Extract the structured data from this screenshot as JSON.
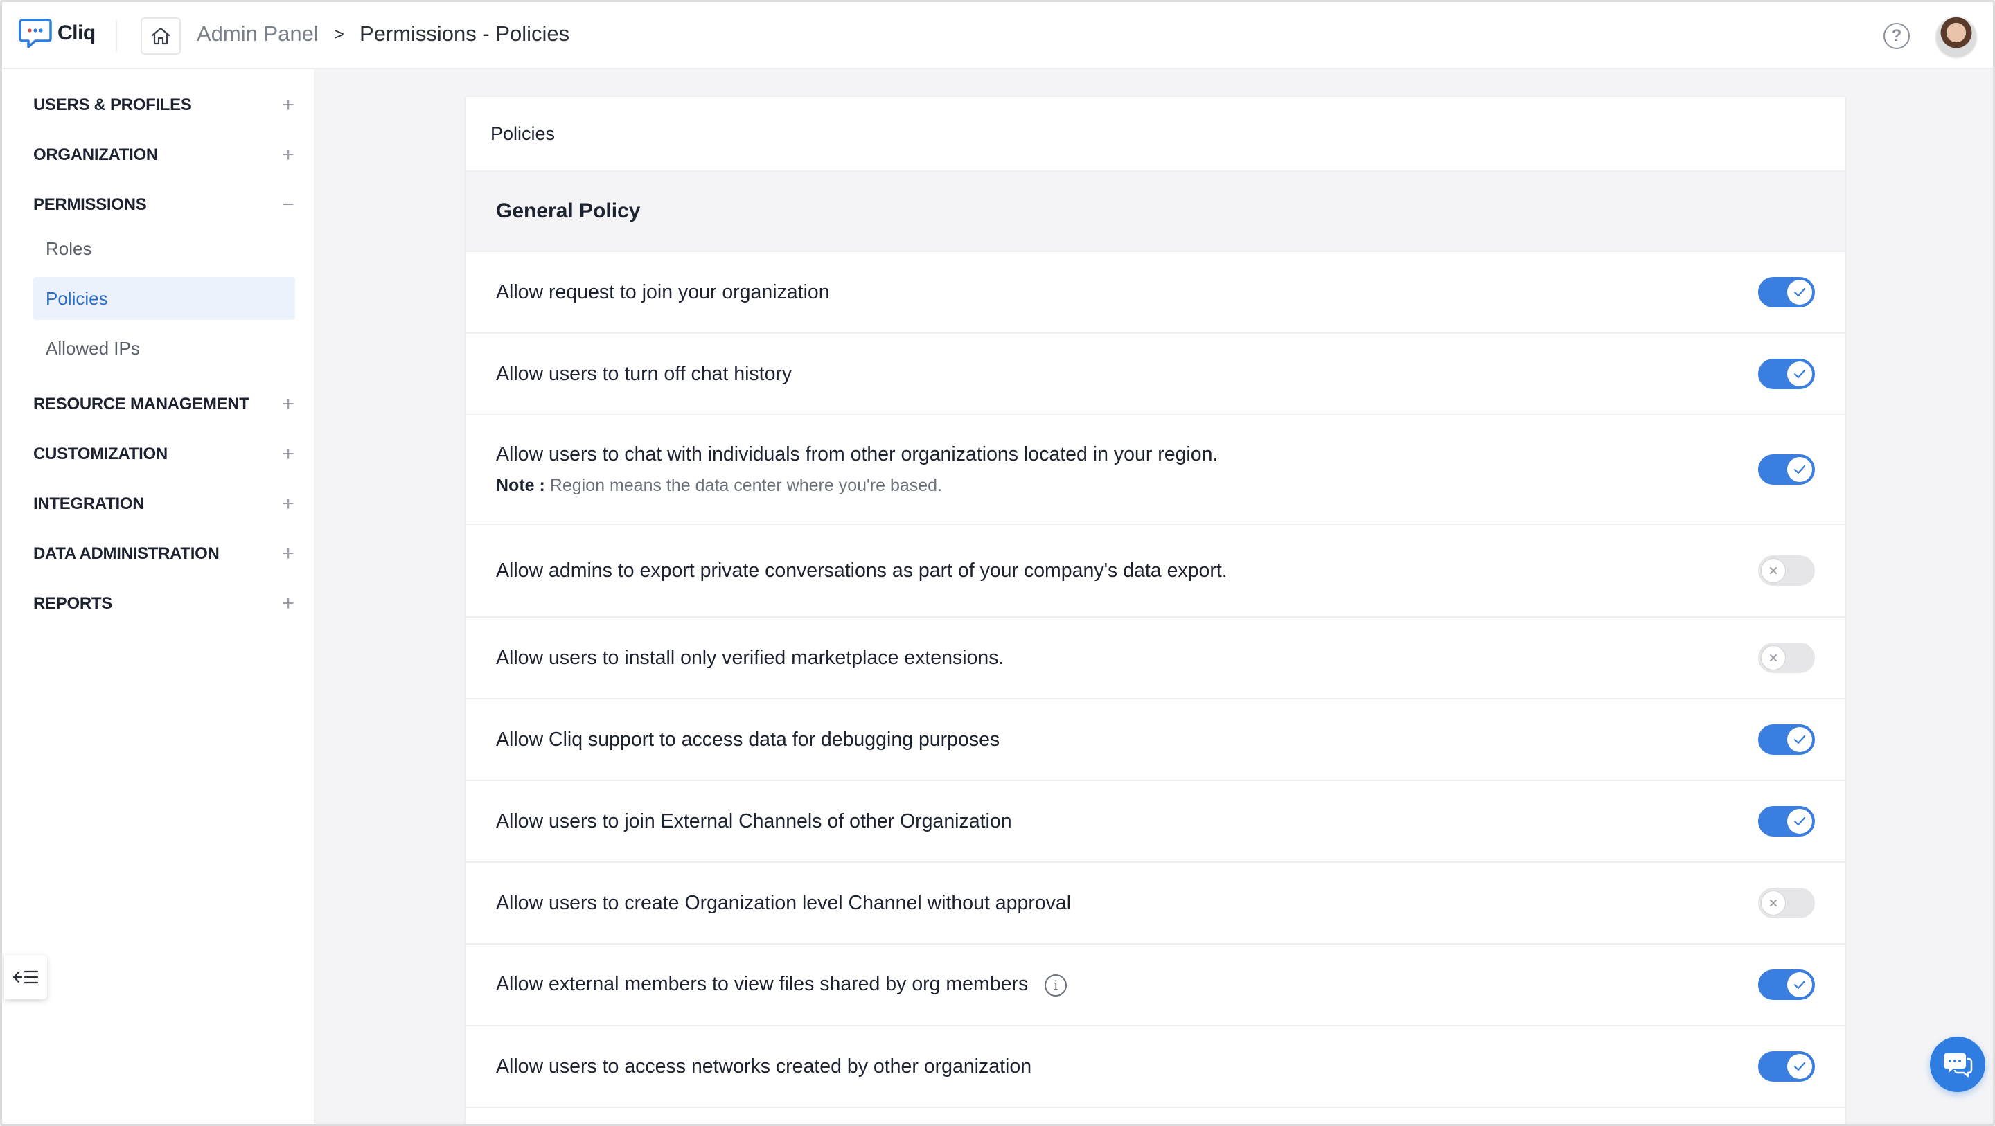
{
  "app": {
    "name": "Cliq"
  },
  "breadcrumb": {
    "root": "Admin Panel",
    "separator": ">",
    "current": "Permissions - Policies"
  },
  "sidebar": {
    "sections": [
      {
        "label": "USERS & PROFILES",
        "toggle": "+"
      },
      {
        "label": "ORGANIZATION",
        "toggle": "+"
      },
      {
        "label": "PERMISSIONS",
        "toggle": "−"
      },
      {
        "label": "RESOURCE MANAGEMENT",
        "toggle": "+"
      },
      {
        "label": "CUSTOMIZATION",
        "toggle": "+"
      },
      {
        "label": "INTEGRATION",
        "toggle": "+"
      },
      {
        "label": "DATA ADMINISTRATION",
        "toggle": "+"
      },
      {
        "label": "REPORTS",
        "toggle": "+"
      }
    ],
    "permissions_items": [
      {
        "label": "Roles",
        "active": false
      },
      {
        "label": "Policies",
        "active": true
      },
      {
        "label": "Allowed IPs",
        "active": false
      }
    ]
  },
  "main": {
    "card_title": "Policies",
    "section_title": "General Policy",
    "policies": [
      {
        "label": "Allow request to join your organization",
        "enabled": true
      },
      {
        "label": "Allow users to turn off chat history",
        "enabled": true
      },
      {
        "label": "Allow users to chat with individuals from other organizations located in your region.",
        "note_label": "Note :",
        "note_text": "Region means the data center where you're based.",
        "enabled": true
      },
      {
        "label": "Allow admins to export private conversations as part of your company's data export.",
        "enabled": false
      },
      {
        "label": "Allow users to install only verified marketplace extensions.",
        "enabled": false
      },
      {
        "label": "Allow Cliq support to access data for debugging purposes",
        "enabled": true
      },
      {
        "label": "Allow users to join External Channels of other Organization",
        "enabled": true
      },
      {
        "label": "Allow users to create Organization level Channel without approval",
        "enabled": false
      },
      {
        "label": "Allow external members to view files shared by org members",
        "has_info": true,
        "enabled": true
      },
      {
        "label": "Allow users to access networks created by other organization",
        "enabled": true
      }
    ]
  },
  "colors": {
    "accent": "#3a7ee0",
    "active_bg": "#ebf2fb",
    "active_text": "#2b6cc4"
  },
  "icons": {
    "home": "home-icon",
    "help": "help-icon",
    "collapse": "collapse-sidebar-icon",
    "chat": "chat-icon"
  }
}
